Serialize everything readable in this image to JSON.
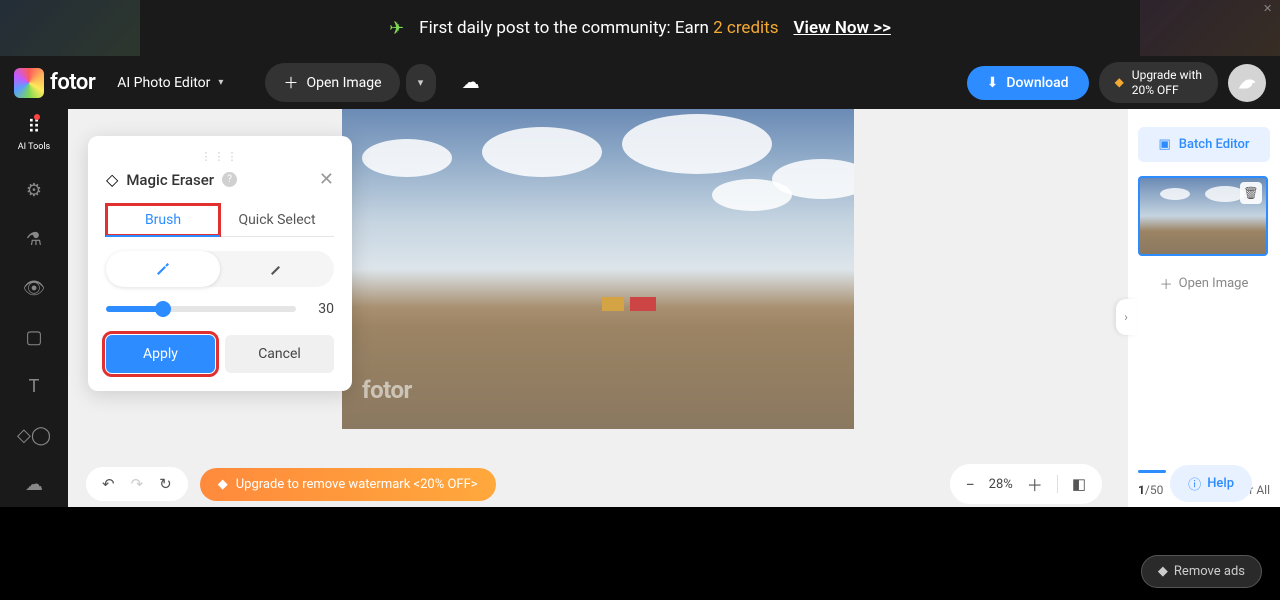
{
  "promo": {
    "text_pre": "First daily post to the community: Earn ",
    "credits": "2 credits",
    "cta": "View Now >>"
  },
  "brand": "fotor",
  "header": {
    "mode": "AI Photo Editor",
    "open_image": "Open Image",
    "download": "Download",
    "upgrade_line1": "Upgrade with",
    "upgrade_line2": "20% OFF"
  },
  "sidebar": {
    "ai_tools": "AI Tools"
  },
  "panel": {
    "title": "Magic Eraser",
    "tab_brush": "Brush",
    "tab_quick": "Quick Select",
    "brush_size": "30",
    "apply": "Apply",
    "cancel": "Cancel"
  },
  "watermark": "fotor",
  "right": {
    "batch": "Batch Editor",
    "open_image": "Open Image",
    "page_current": "1",
    "page_sep_total": "/50",
    "clear_all": "Clear All"
  },
  "bottom": {
    "upgrade_watermark": "Upgrade to remove watermark <20% OFF>",
    "zoom": "28%"
  },
  "help": "Help",
  "remove_ads": "Remove ads"
}
